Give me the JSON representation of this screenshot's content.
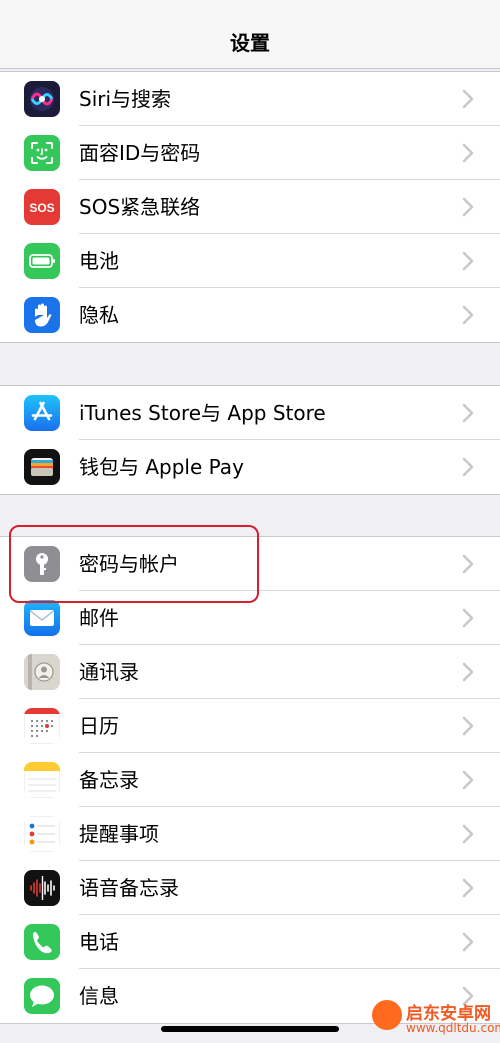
{
  "navbar": {
    "title": "设置"
  },
  "group1": [
    {
      "label": "Siri与搜索",
      "icon": "siri-icon"
    },
    {
      "label": "面容ID与密码",
      "icon": "face-id-icon"
    },
    {
      "label": "SOS紧急联络",
      "icon": "sos-icon",
      "icon_text": "SOS"
    },
    {
      "label": "电池",
      "icon": "battery-icon"
    },
    {
      "label": "隐私",
      "icon": "privacy-hand-icon"
    }
  ],
  "group2": [
    {
      "label": "iTunes Store与 App Store",
      "icon": "app-store-icon"
    },
    {
      "label": "钱包与 Apple Pay",
      "icon": "wallet-icon"
    }
  ],
  "group3": [
    {
      "label": "密码与帐户",
      "icon": "passwords-key-icon"
    },
    {
      "label": "邮件",
      "icon": "mail-icon"
    },
    {
      "label": "通讯录",
      "icon": "contacts-icon"
    },
    {
      "label": "日历",
      "icon": "calendar-icon"
    },
    {
      "label": "备忘录",
      "icon": "notes-icon"
    },
    {
      "label": "提醒事项",
      "icon": "reminders-icon"
    },
    {
      "label": "语音备忘录",
      "icon": "voice-memos-icon"
    },
    {
      "label": "电话",
      "icon": "phone-icon"
    },
    {
      "label": "信息",
      "icon": "messages-icon"
    }
  ],
  "watermark": {
    "name": "启东安卓网",
    "url": "www.qdltdu.com"
  },
  "colors": {
    "highlight": "#d4202f",
    "chevron": "#c7c7cc",
    "background": "#efeff4"
  }
}
